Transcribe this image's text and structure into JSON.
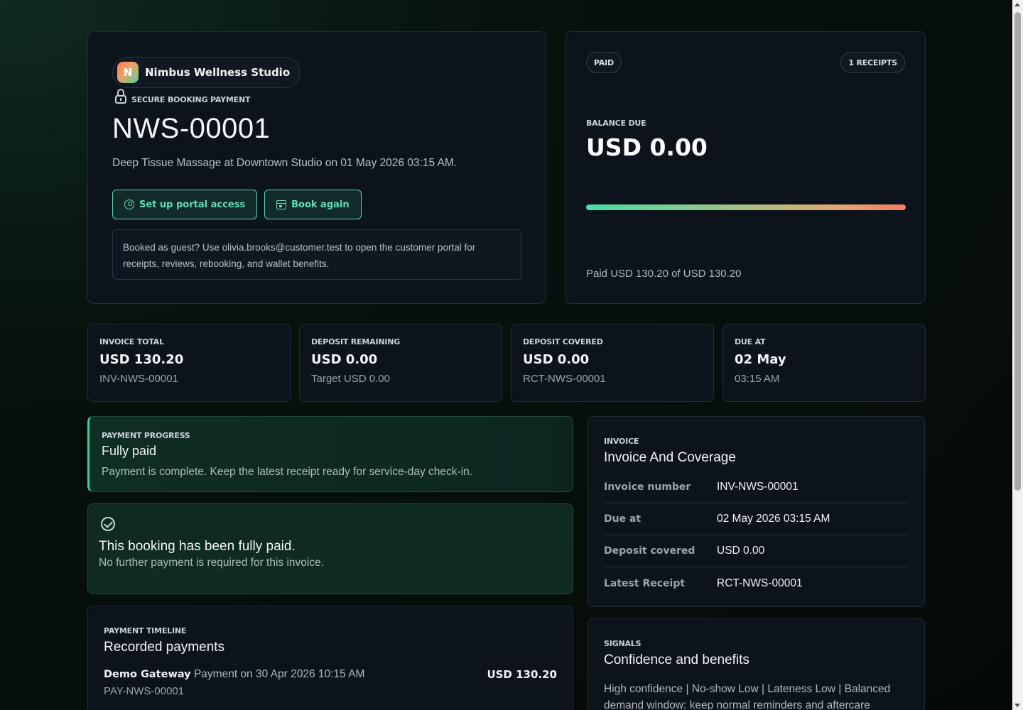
{
  "hero": {
    "brand_initial": "N",
    "brand_name": "Nimbus Wellness Studio",
    "secure_label": "SECURE BOOKING PAYMENT",
    "booking_ref": "NWS-00001",
    "description": "Deep Tissue Massage at Downtown Studio on 01 May 2026 03:15 AM.",
    "portal_button": "Set up portal access",
    "book_again_button": "Book again",
    "guest_note": "Booked as guest? Use olivia.brooks@customer.test to open the customer portal for receipts, reviews, rebooking, and wallet benefits."
  },
  "balance": {
    "status_chip": "PAID",
    "receipts_chip": "1 RECEIPTS",
    "label": "BALANCE DUE",
    "amount": "USD 0.00",
    "progress_fraction": 1.0,
    "paid_text": "Paid USD 130.20 of USD 130.20"
  },
  "stats": [
    {
      "label": "INVOICE TOTAL",
      "value": "USD 130.20",
      "sub": "INV-NWS-00001"
    },
    {
      "label": "DEPOSIT REMAINING",
      "value": "USD 0.00",
      "sub": "Target USD 0.00"
    },
    {
      "label": "DEPOSIT COVERED",
      "value": "USD 0.00",
      "sub": "RCT-NWS-00001"
    },
    {
      "label": "DUE AT",
      "value": "02 May",
      "sub": "03:15 AM"
    }
  ],
  "progress": {
    "label": "PAYMENT PROGRESS",
    "title": "Fully paid",
    "description": "Payment is complete. Keep the latest receipt ready for service-day check-in."
  },
  "fully_paid": {
    "title": "This booking has been fully paid.",
    "description": "No further payment is required for this invoice."
  },
  "timeline": {
    "label": "PAYMENT TIMELINE",
    "title": "Recorded payments",
    "payments": [
      {
        "gateway": "Demo Gateway",
        "detail": "Payment on 30 Apr 2026 10:15 AM",
        "amount": "USD 130.20",
        "ref": "PAY-NWS-00001"
      }
    ]
  },
  "invoice": {
    "label": "INVOICE",
    "title": "Invoice And Coverage",
    "rows": [
      {
        "key": "Invoice number",
        "value": "INV-NWS-00001"
      },
      {
        "key": "Due at",
        "value": "02 May 2026 03:15 AM"
      },
      {
        "key": "Deposit covered",
        "value": "USD 0.00"
      },
      {
        "key": "Latest Receipt",
        "value": "RCT-NWS-00001"
      }
    ]
  },
  "signals": {
    "label": "SIGNALS",
    "title": "Confidence and benefits",
    "description": "High confidence | No-show Low | Lateness Low | Balanced demand window: keep normal reminders and aftercare"
  },
  "colors": {
    "accent": "#5fe0b4",
    "success_bg": "#0e2a22",
    "progress_start": "#46dca6",
    "progress_end": "#f47b62"
  }
}
